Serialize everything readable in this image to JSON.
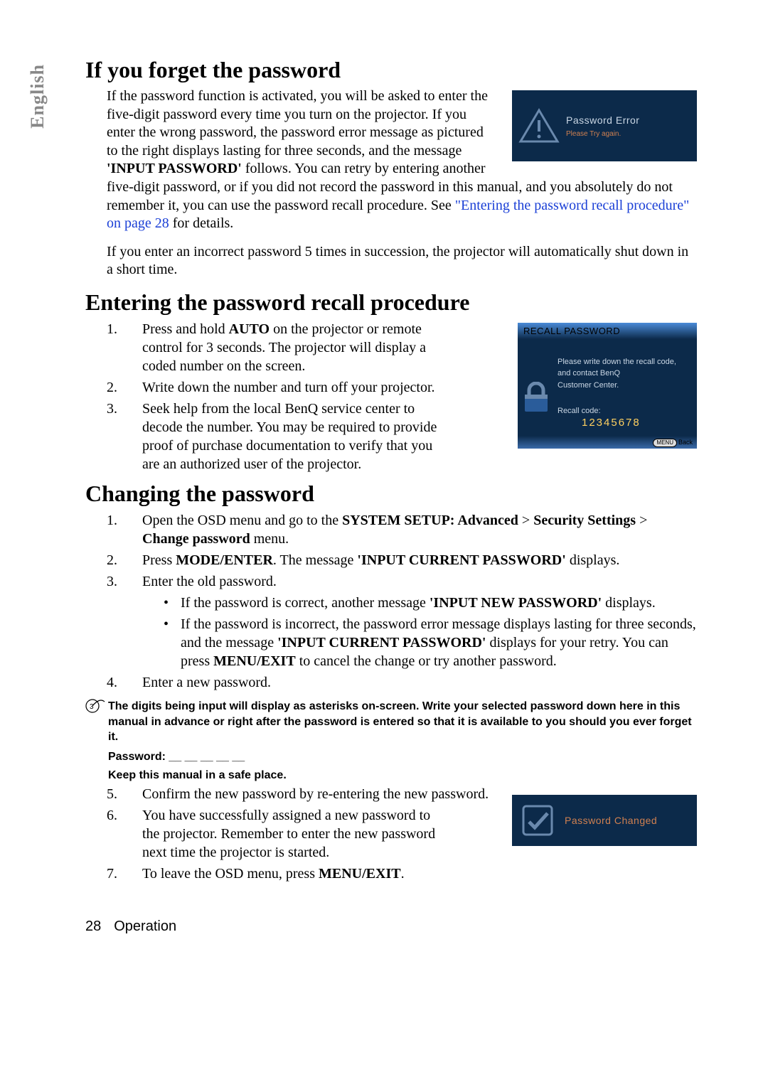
{
  "lang_tab": "English",
  "section1": {
    "heading": "If you forget the password",
    "p1_a": "If the password function is activated, you will be asked to enter the five-digit password every time you turn on the projector. If you enter the wrong password, the password error message as pictured to the right displays lasting for three seconds, and the message ",
    "p1_bold": "'INPUT PASSWORD'",
    "p1_b": " follows. You can retry by entering another five-digit password, or if you did not record the password in this manual, and you absolutely do not remember it, you can use the password recall procedure. See ",
    "p1_link": "\"Entering the password recall procedure\" on page 28",
    "p1_c": " for details.",
    "p2": "If you enter an incorrect password 5 times in succession, the projector will automatically shut down in a short time."
  },
  "err_box": {
    "title": "Password Error",
    "sub": "Please Try again."
  },
  "section2": {
    "heading": "Entering the password recall procedure",
    "li1_a": "Press and hold ",
    "li1_bold": "AUTO",
    "li1_b": " on the projector or remote control for 3 seconds. The projector will display a coded number on the screen.",
    "li2": "Write down the number and turn off your projector.",
    "li3": "Seek help from the local BenQ service center to decode the number. You may be required to provide proof of purchase documentation to verify that you are an authorized user of the projector."
  },
  "recall_box": {
    "header": "RECALL PASSWORD",
    "msg1": "Please write down the recall code,",
    "msg2": "and contact BenQ",
    "msg3": "Customer Center.",
    "code_label": "Recall code:",
    "code": "12345678",
    "menu": "MENU",
    "back": "Back"
  },
  "section3": {
    "heading": "Changing the password",
    "li1_a": "Open the OSD menu and go to the ",
    "li1_b1": "SYSTEM SETUP: Advanced",
    "li1_gt1": " > ",
    "li1_b2": "Security Settings",
    "li1_gt2": " > ",
    "li1_b3": "Change password",
    "li1_c": " menu.",
    "li2_a": "Press ",
    "li2_b1": "MODE/ENTER",
    "li2_mid": ". The message ",
    "li2_b2": "'INPUT CURRENT PASSWORD'",
    "li2_c": " displays.",
    "li3": "Enter the old password.",
    "b1_a": "If the password is correct, another message ",
    "b1_bold": "'INPUT NEW PASSWORD'",
    "b1_b": " displays.",
    "b2_a": "If the password is incorrect, the password error message displays lasting for three seconds, and the message ",
    "b2_bold1": "'INPUT CURRENT PASSWORD'",
    "b2_mid": " displays for your retry. You can press ",
    "b2_bold2": "MENU/EXIT",
    "b2_b": " to cancel the change or try another password.",
    "li4": "Enter a new password.",
    "note1": "The digits being input will display as asterisks on-screen. Write your selected password down here in this manual in advance or right after the password is entered so that it is available to you should you ever forget it.",
    "note2": "Password: __ __ __ __ __",
    "note3": "Keep this manual in a safe place.",
    "li5": "Confirm the new password by re-entering the new password.",
    "li6": "You have successfully assigned a new password to the projector. Remember to enter the new password next time the projector is started.",
    "li7_a": "To leave the OSD menu, press ",
    "li7_bold": "MENU/EXIT",
    "li7_b": "."
  },
  "changed_box": {
    "text": "Password Changed"
  },
  "footer": {
    "page": "28",
    "section": "Operation"
  }
}
